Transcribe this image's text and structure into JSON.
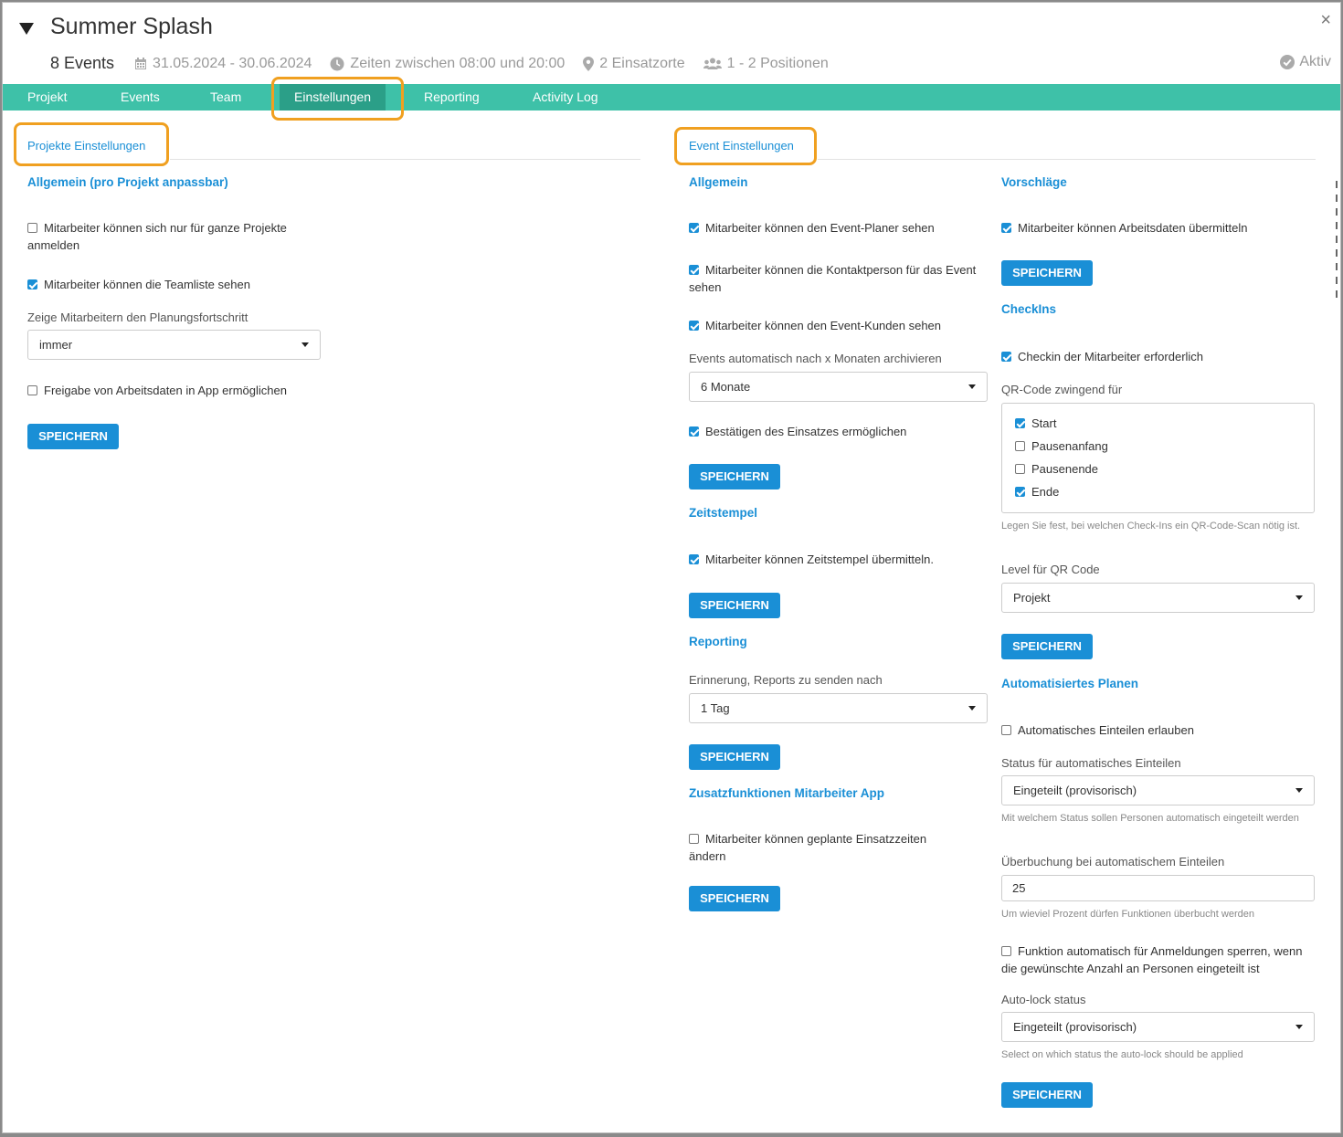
{
  "header": {
    "title": "Summer Splash",
    "close": "×",
    "events_count": "8 Events",
    "date_range": "31.05.2024 - 30.06.2024",
    "times": "Zeiten zwischen 08:00 und 20:00",
    "locations": "2 Einsatzorte",
    "positions": "1 - 2 Positionen",
    "status": "Aktiv"
  },
  "tabs": [
    "Projekt",
    "Events",
    "Team",
    "Einstellungen",
    "Reporting",
    "Activity Log"
  ],
  "colors": {
    "tabbar": "#3ec1a8",
    "tab_active": "#2b9f88",
    "accent": "#1a8fd6",
    "highlight": "#f0a020"
  },
  "project": {
    "title": "Projekte Einstellungen",
    "general_title": "Allgemein (pro Projekt anpassbar)",
    "opt_whole_projects": "Mitarbeiter können sich nur für ganze Projekte anmelden",
    "opt_whole_projects_checked": false,
    "opt_teamlist": "Mitarbeiter können die Teamliste sehen",
    "opt_teamlist_checked": true,
    "progress_label": "Zeige Mitarbeitern den Planungsfortschritt",
    "progress_value": "immer",
    "opt_release": "Freigabe von Arbeitsdaten in App ermöglichen",
    "opt_release_checked": false,
    "save": "SPEICHERN"
  },
  "event": {
    "title": "Event Einstellungen",
    "general": {
      "title": "Allgemein",
      "opt_planner": "Mitarbeiter können den Event-Planer sehen",
      "opt_contact": "Mitarbeiter können die Kontaktperson für das Event sehen",
      "opt_customer": "Mitarbeiter können den Event-Kunden sehen",
      "archive_label": "Events automatisch nach x Monaten archivieren",
      "archive_value": "6 Monate",
      "opt_confirm": "Bestätigen des Einsatzes ermöglichen",
      "save": "SPEICHERN"
    },
    "timestamps": {
      "title": "Zeitstempel",
      "opt_timestamps": "Mitarbeiter können Zeitstempel übermitteln.",
      "save": "SPEICHERN"
    },
    "reporting": {
      "title": "Reporting",
      "reminder_label": "Erinnerung, Reports zu senden nach",
      "reminder_value": "1 Tag",
      "save": "SPEICHERN"
    },
    "extras": {
      "title": "Zusatzfunktionen Mitarbeiter App",
      "opt_change_times": "Mitarbeiter können geplante Einsatzzeiten ändern",
      "save": "SPEICHERN"
    },
    "suggestions": {
      "title": "Vorschläge",
      "opt_workdata": "Mitarbeiter können Arbeitsdaten übermitteln",
      "save": "SPEICHERN"
    },
    "checkins": {
      "title": "CheckIns",
      "opt_required": "Checkin der Mitarbeiter erforderlich",
      "qr_label": "QR-Code zwingend für",
      "qr_options": [
        {
          "label": "Start",
          "checked": true
        },
        {
          "label": "Pausenanfang",
          "checked": false
        },
        {
          "label": "Pausenende",
          "checked": false
        },
        {
          "label": "Ende",
          "checked": true
        }
      ],
      "qr_help": "Legen Sie fest, bei welchen Check-Ins ein QR-Code-Scan nötig ist.",
      "level_label": "Level für QR Code",
      "level_value": "Projekt",
      "save": "SPEICHERN"
    },
    "auto": {
      "title": "Automatisiertes Planen",
      "opt_allow": "Automatisches Einteilen erlauben",
      "status_label": "Status für automatisches Einteilen",
      "status_value": "Eingeteilt (provisorisch)",
      "status_help": "Mit welchem Status sollen Personen automatisch eingeteilt werden",
      "overbook_label": "Überbuchung bei automatischem Einteilen",
      "overbook_value": "25",
      "overbook_help": "Um wieviel Prozent dürfen Funktionen überbucht werden",
      "opt_lock": "Funktion automatisch für Anmeldungen sperren, wenn die gewünschte Anzahl an Personen eingeteilt ist",
      "lock_label": "Auto-lock status",
      "lock_value": "Eingeteilt (provisorisch)",
      "lock_help": "Select on which status the auto-lock should be applied",
      "save": "SPEICHERN"
    }
  }
}
